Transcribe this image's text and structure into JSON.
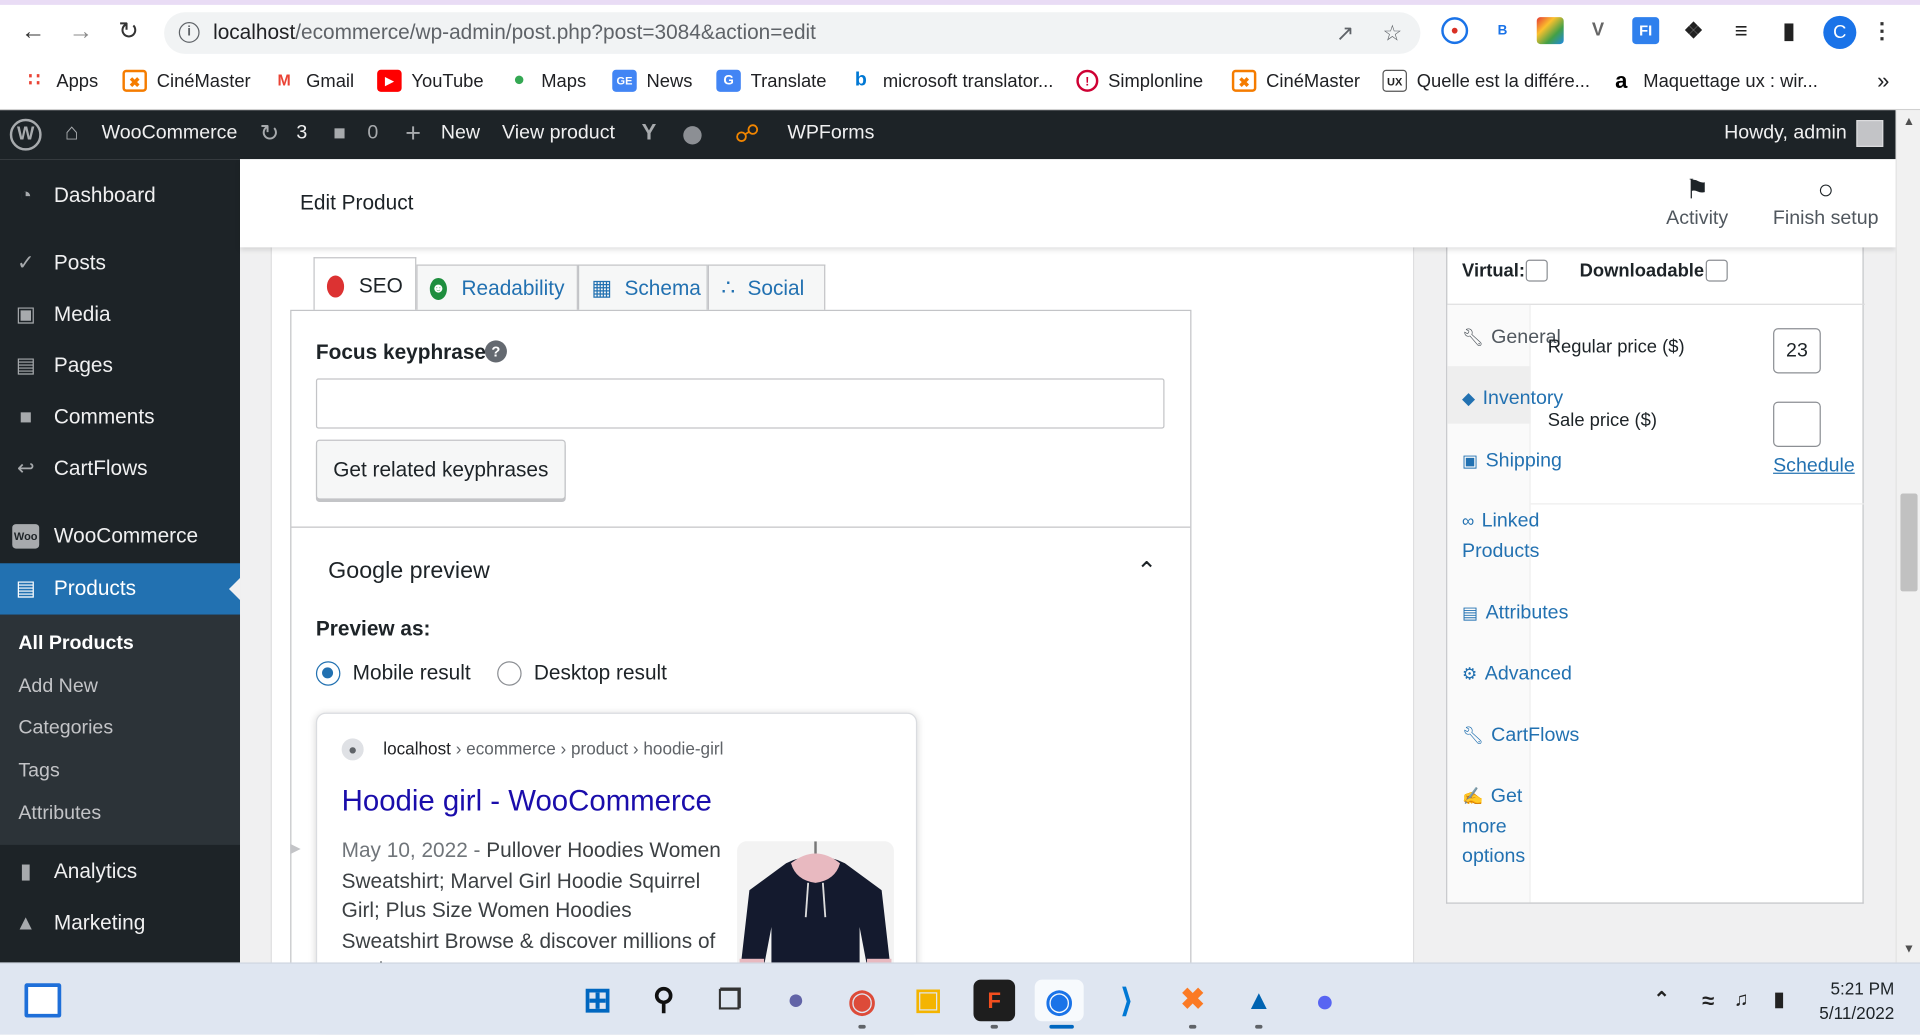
{
  "browser": {
    "url_host": "localhost",
    "url_path": "/ecommerce/wp-admin/post.php?post=3084&action=edit",
    "bookmarks": [
      {
        "label": "Apps",
        "icon": "apps-grid-icon"
      },
      {
        "label": "CinéMaster",
        "icon": "cinemaster-icon"
      },
      {
        "label": "Gmail",
        "icon": "gmail-icon"
      },
      {
        "label": "YouTube",
        "icon": "youtube-icon"
      },
      {
        "label": "Maps",
        "icon": "maps-icon"
      },
      {
        "label": "News",
        "icon": "news-icon"
      },
      {
        "label": "Translate",
        "icon": "translate-icon"
      },
      {
        "label": "microsoft translator...",
        "icon": "bing-icon"
      },
      {
        "label": "Simplonline",
        "icon": "simplonline-icon"
      },
      {
        "label": "CinéMaster",
        "icon": "cinemaster-icon"
      },
      {
        "label": "Quelle est la différe...",
        "icon": "blog-ux-icon"
      },
      {
        "label": "Maquettage ux : wir...",
        "icon": "amazon-icon"
      }
    ],
    "more": "»",
    "profile_initial": "C"
  },
  "adminbar": {
    "site": "WooCommerce",
    "updates": "3",
    "comments": "0",
    "new": "New",
    "view_product": "View product",
    "wpforms": "WPForms",
    "howdy": "Howdy, admin"
  },
  "sidebar": {
    "items": [
      {
        "label": "Dashboard",
        "icon": "dashboard-icon"
      },
      {
        "label": "Posts",
        "icon": "pin-icon"
      },
      {
        "label": "Media",
        "icon": "media-icon"
      },
      {
        "label": "Pages",
        "icon": "pages-icon"
      },
      {
        "label": "Comments",
        "icon": "comments-icon"
      },
      {
        "label": "CartFlows",
        "icon": "cartflows-icon"
      },
      {
        "label": "WooCommerce",
        "icon": "woo-icon"
      },
      {
        "label": "Products",
        "icon": "products-icon"
      },
      {
        "label": "Analytics",
        "icon": "analytics-icon"
      },
      {
        "label": "Marketing",
        "icon": "megaphone-icon"
      }
    ],
    "submenu": [
      "All Products",
      "Add New",
      "Categories",
      "Tags",
      "Attributes"
    ]
  },
  "header": {
    "title": "Edit Product",
    "activity": "Activity",
    "finish_setup": "Finish setup"
  },
  "yoast": {
    "tabs": [
      "SEO",
      "Readability",
      "Schema",
      "Social"
    ],
    "focus_label": "Focus keyphrase",
    "focus_value": "",
    "related_button": "Get related keyphrases",
    "google_preview": "Google preview",
    "preview_as": "Preview as:",
    "mobile": "Mobile result",
    "desktop": "Desktop result",
    "selected": "Mobile result",
    "card": {
      "host": "localhost",
      "path": " › ecommerce › product › hoodie-girl",
      "title": "Hoodie girl - WooCommerce",
      "date": "May 10, 2022",
      "dash": " - ",
      "desc": "Pullover Hoodies Women Sweatshirt; Marvel Girl Hoodie Squirrel Girl; Plus Size Women Hoodies Sweatshirt Browse & discover millions of products"
    }
  },
  "product_data": {
    "virtual": "Virtual:",
    "downloadable": "Downloadable:",
    "tabs": [
      {
        "label": "General",
        "icon": "wrench-icon"
      },
      {
        "label": "Inventory",
        "icon": "tag-icon"
      },
      {
        "label": "Shipping",
        "icon": "truck-icon"
      },
      {
        "label": "Linked",
        "label2": "Products",
        "icon": "link-icon"
      },
      {
        "label": "Attributes",
        "icon": "list-icon"
      },
      {
        "label": "Advanced",
        "icon": "gear-icon"
      },
      {
        "label": "CartFlows",
        "icon": "wrench-icon"
      },
      {
        "label": "Get",
        "label2": "more",
        "label3": "options",
        "icon": "plugin-icon"
      }
    ],
    "regular_price_label": "Regular price ($)",
    "regular_price": "23",
    "sale_price_label": "Sale price ($)",
    "sale_price": "",
    "schedule": "Schedule"
  },
  "taskbar": {
    "time": "5:21 PM",
    "date": "5/11/2022"
  }
}
